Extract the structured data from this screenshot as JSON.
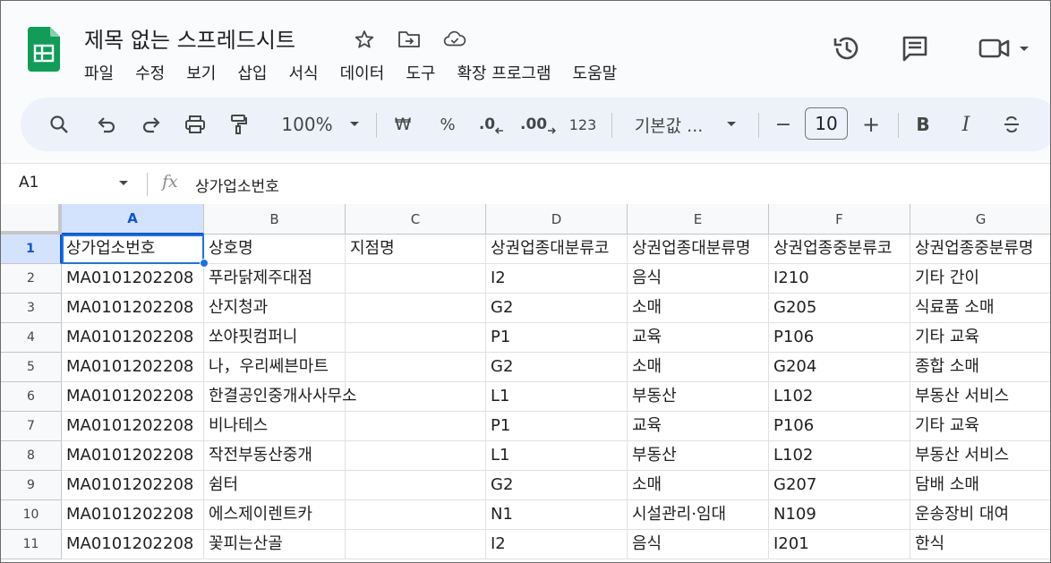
{
  "header": {
    "title": "제목 없는 스프레드시트",
    "menu": [
      "파일",
      "수정",
      "보기",
      "삽입",
      "서식",
      "데이터",
      "도구",
      "확장 프로그램",
      "도움말"
    ]
  },
  "toolbar": {
    "zoom": "100%",
    "currency": "₩",
    "percent": "%",
    "decimal_decrease": ".0",
    "decimal_increase": ".00",
    "number_format": "123",
    "font": "기본값 ...",
    "font_size": "10",
    "minus": "−",
    "plus": "+",
    "bold": "B",
    "italic": "I"
  },
  "formula_bar": {
    "cell_ref": "A1",
    "fx": "fx",
    "content": "상가업소번호"
  },
  "grid": {
    "columns": [
      "A",
      "B",
      "C",
      "D",
      "E",
      "F",
      "G"
    ],
    "rows": [
      {
        "num": "1",
        "a": "상가업소번호",
        "b": "상호명",
        "c": "지점명",
        "d": "상권업종대분류코",
        "e": "상권업종대분류명",
        "f": "상권업종중분류코",
        "g": "상권업종중분류명"
      },
      {
        "num": "2",
        "a": "MA0101202208",
        "b": "푸라닭제주대점",
        "c": "",
        "d": "I2",
        "e": "음식",
        "f": "I210",
        "g": "기타 간이"
      },
      {
        "num": "3",
        "a": "MA0101202208",
        "b": "산지청과",
        "c": "",
        "d": "G2",
        "e": "소매",
        "f": "G205",
        "g": "식료품 소매"
      },
      {
        "num": "4",
        "a": "MA0101202208",
        "b": "쏘야핏컴퍼니",
        "c": "",
        "d": "P1",
        "e": "교육",
        "f": "P106",
        "g": "기타 교육"
      },
      {
        "num": "5",
        "a": "MA0101202208",
        "b": "나，우리쎄븐마트",
        "c": "",
        "d": "G2",
        "e": "소매",
        "f": "G204",
        "g": "종합 소매"
      },
      {
        "num": "6",
        "a": "MA0101202208",
        "b": "한결공인중개사사무소",
        "c": "",
        "d": "L1",
        "e": "부동산",
        "f": "L102",
        "g": "부동산 서비스"
      },
      {
        "num": "7",
        "a": "MA0101202208",
        "b": "비나테스",
        "c": "",
        "d": "P1",
        "e": "교육",
        "f": "P106",
        "g": "기타 교육"
      },
      {
        "num": "8",
        "a": "MA0101202208",
        "b": "작전부동산중개",
        "c": "",
        "d": "L1",
        "e": "부동산",
        "f": "L102",
        "g": "부동산 서비스"
      },
      {
        "num": "9",
        "a": "MA0101202208",
        "b": "쉼터",
        "c": "",
        "d": "G2",
        "e": "소매",
        "f": "G207",
        "g": "담배 소매"
      },
      {
        "num": "10",
        "a": "MA0101202208",
        "b": "에스제이렌트카",
        "c": "",
        "d": "N1",
        "e": "시설관리·임대",
        "f": "N109",
        "g": "운송장비 대여"
      },
      {
        "num": "11",
        "a": "MA0101202208",
        "b": "꽃피는산골",
        "c": "",
        "d": "I2",
        "e": "음식",
        "f": "I201",
        "g": "한식"
      }
    ]
  },
  "colors": {
    "accent": "#1a73e8",
    "logo": "#0f9d58",
    "toolbar_bg": "#edf2fa",
    "selected_header": "#d3e3fd"
  },
  "icons": {
    "title": [
      "star-icon",
      "move-to-folder-icon",
      "cloud-saved-icon"
    ],
    "header": [
      "history-icon",
      "comment-icon",
      "meet-video-icon"
    ],
    "toolbar": [
      "search-icon",
      "undo-icon",
      "redo-icon",
      "print-icon",
      "paint-format-icon",
      "strikethrough-icon"
    ]
  }
}
